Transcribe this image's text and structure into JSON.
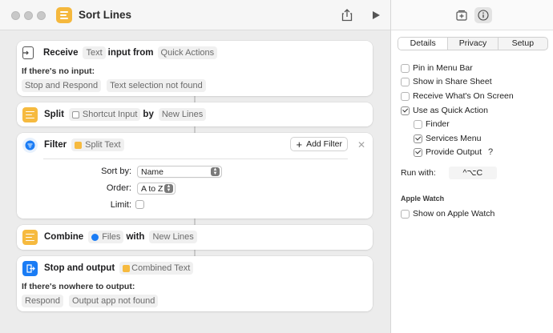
{
  "window": {
    "title": "Sort Lines"
  },
  "colors": {
    "accent_blue": "#1a7cf5",
    "shortcut_yellow": "#f6ba3f"
  },
  "actions": {
    "receive": {
      "verb": "Receive",
      "type_token": "Text",
      "connector": "input from",
      "source_token": "Quick Actions",
      "no_input_label": "If there's no input:",
      "behavior_token": "Stop and Respond",
      "message_token": "Text selection not found"
    },
    "split": {
      "verb": "Split",
      "input_token": "Shortcut Input",
      "connector": "by",
      "separator_token": "New Lines"
    },
    "filter": {
      "verb": "Filter",
      "input_token": "Split Text",
      "add_filter_label": "Add Filter",
      "sort_by_label": "Sort by:",
      "sort_by_value": "Name",
      "order_label": "Order:",
      "order_value": "A to Z",
      "limit_label": "Limit:"
    },
    "combine": {
      "verb": "Combine",
      "input_token": "Files",
      "connector": "with",
      "separator_token": "New Lines"
    },
    "stop_output": {
      "verb": "Stop and output",
      "input_token": "Combined Text",
      "nowhere_label": "If there's nowhere to output:",
      "behavior_token": "Respond",
      "message_token": "Output app not found"
    }
  },
  "sidebar": {
    "tabs": [
      "Details",
      "Privacy",
      "Setup"
    ],
    "active_tab": "Details",
    "options": [
      {
        "label": "Pin in Menu Bar",
        "checked": false
      },
      {
        "label": "Show in Share Sheet",
        "checked": false
      },
      {
        "label": "Receive What's On Screen",
        "checked": false
      },
      {
        "label": "Use as Quick Action",
        "checked": true
      }
    ],
    "quick_action_options": [
      {
        "label": "Finder",
        "checked": false
      },
      {
        "label": "Services Menu",
        "checked": true
      },
      {
        "label": "Provide Output",
        "checked": true
      }
    ],
    "help_glyph": "?",
    "run_with_label": "Run with:",
    "shortcut": "^⌥C",
    "apple_watch_title": "Apple Watch",
    "apple_watch_option": {
      "label": "Show on Apple Watch",
      "checked": false
    }
  }
}
